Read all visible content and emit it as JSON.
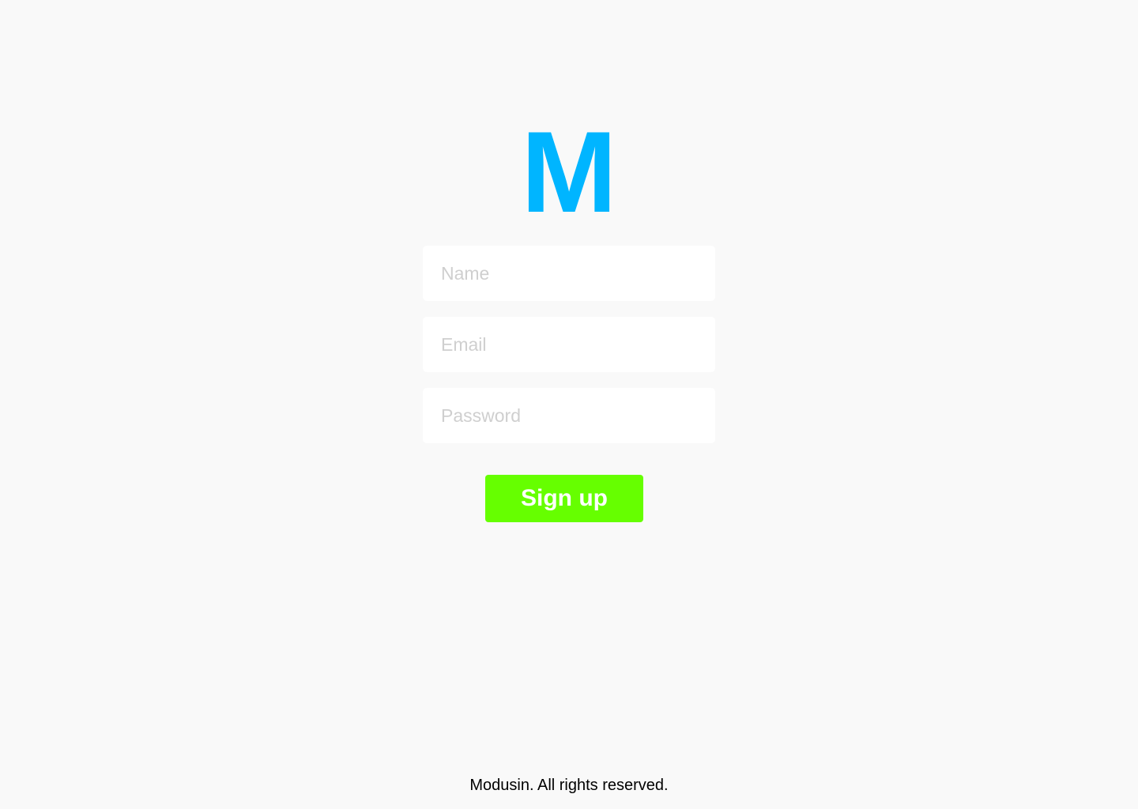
{
  "logo": {
    "text": "M",
    "color": "#00b5ff"
  },
  "form": {
    "name_placeholder": "Name",
    "email_placeholder": "Email",
    "password_placeholder": "Password",
    "submit_label": "Sign up",
    "submit_color": "#66ff00"
  },
  "footer": {
    "text": "Modusin. All rights reserved."
  }
}
